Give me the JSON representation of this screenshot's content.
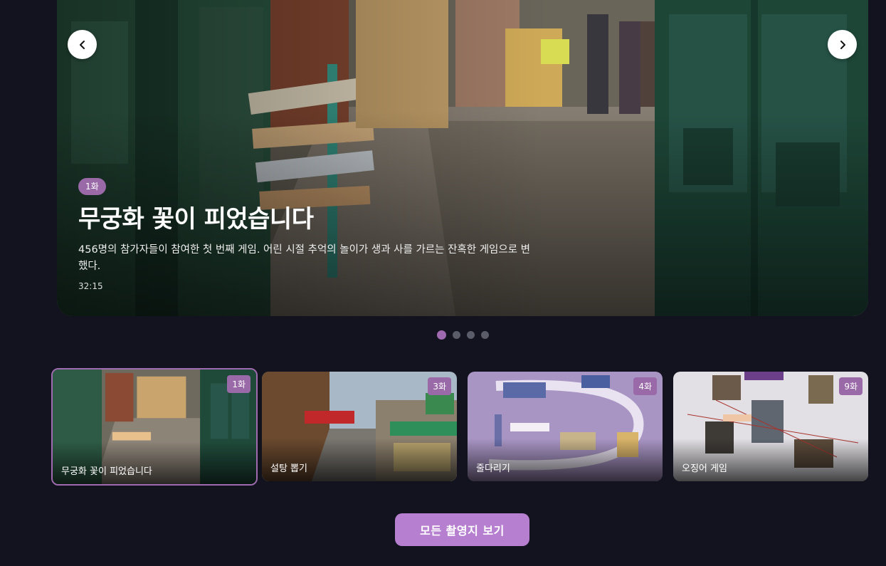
{
  "hero": {
    "badge": "1화",
    "title": "무궁화 꽃이 피었습니다",
    "description": "456명의 참가자들이 참여한 첫 번째 게임. 어린 시절 추억의 놀이가 생과 사를 가르는 잔혹한 게임으로 변했다.",
    "duration": "32:15",
    "prev_icon": "chevron-left-icon",
    "next_icon": "chevron-right-icon"
  },
  "carousel": {
    "dot_count": 4,
    "active_index": 0
  },
  "thumbnails": [
    {
      "badge": "1화",
      "label": "무궁화 꽃이 피었습니다"
    },
    {
      "badge": "3화",
      "label": "설탕 뽑기"
    },
    {
      "badge": "4화",
      "label": "줄다리기"
    },
    {
      "badge": "9화",
      "label": "오징어 게임"
    }
  ],
  "actions": {
    "view_all_label": "모든 촬영지 보기"
  },
  "colors": {
    "background": "#12131f",
    "accent": "#9a6aa8",
    "button": "#b67fd0"
  }
}
